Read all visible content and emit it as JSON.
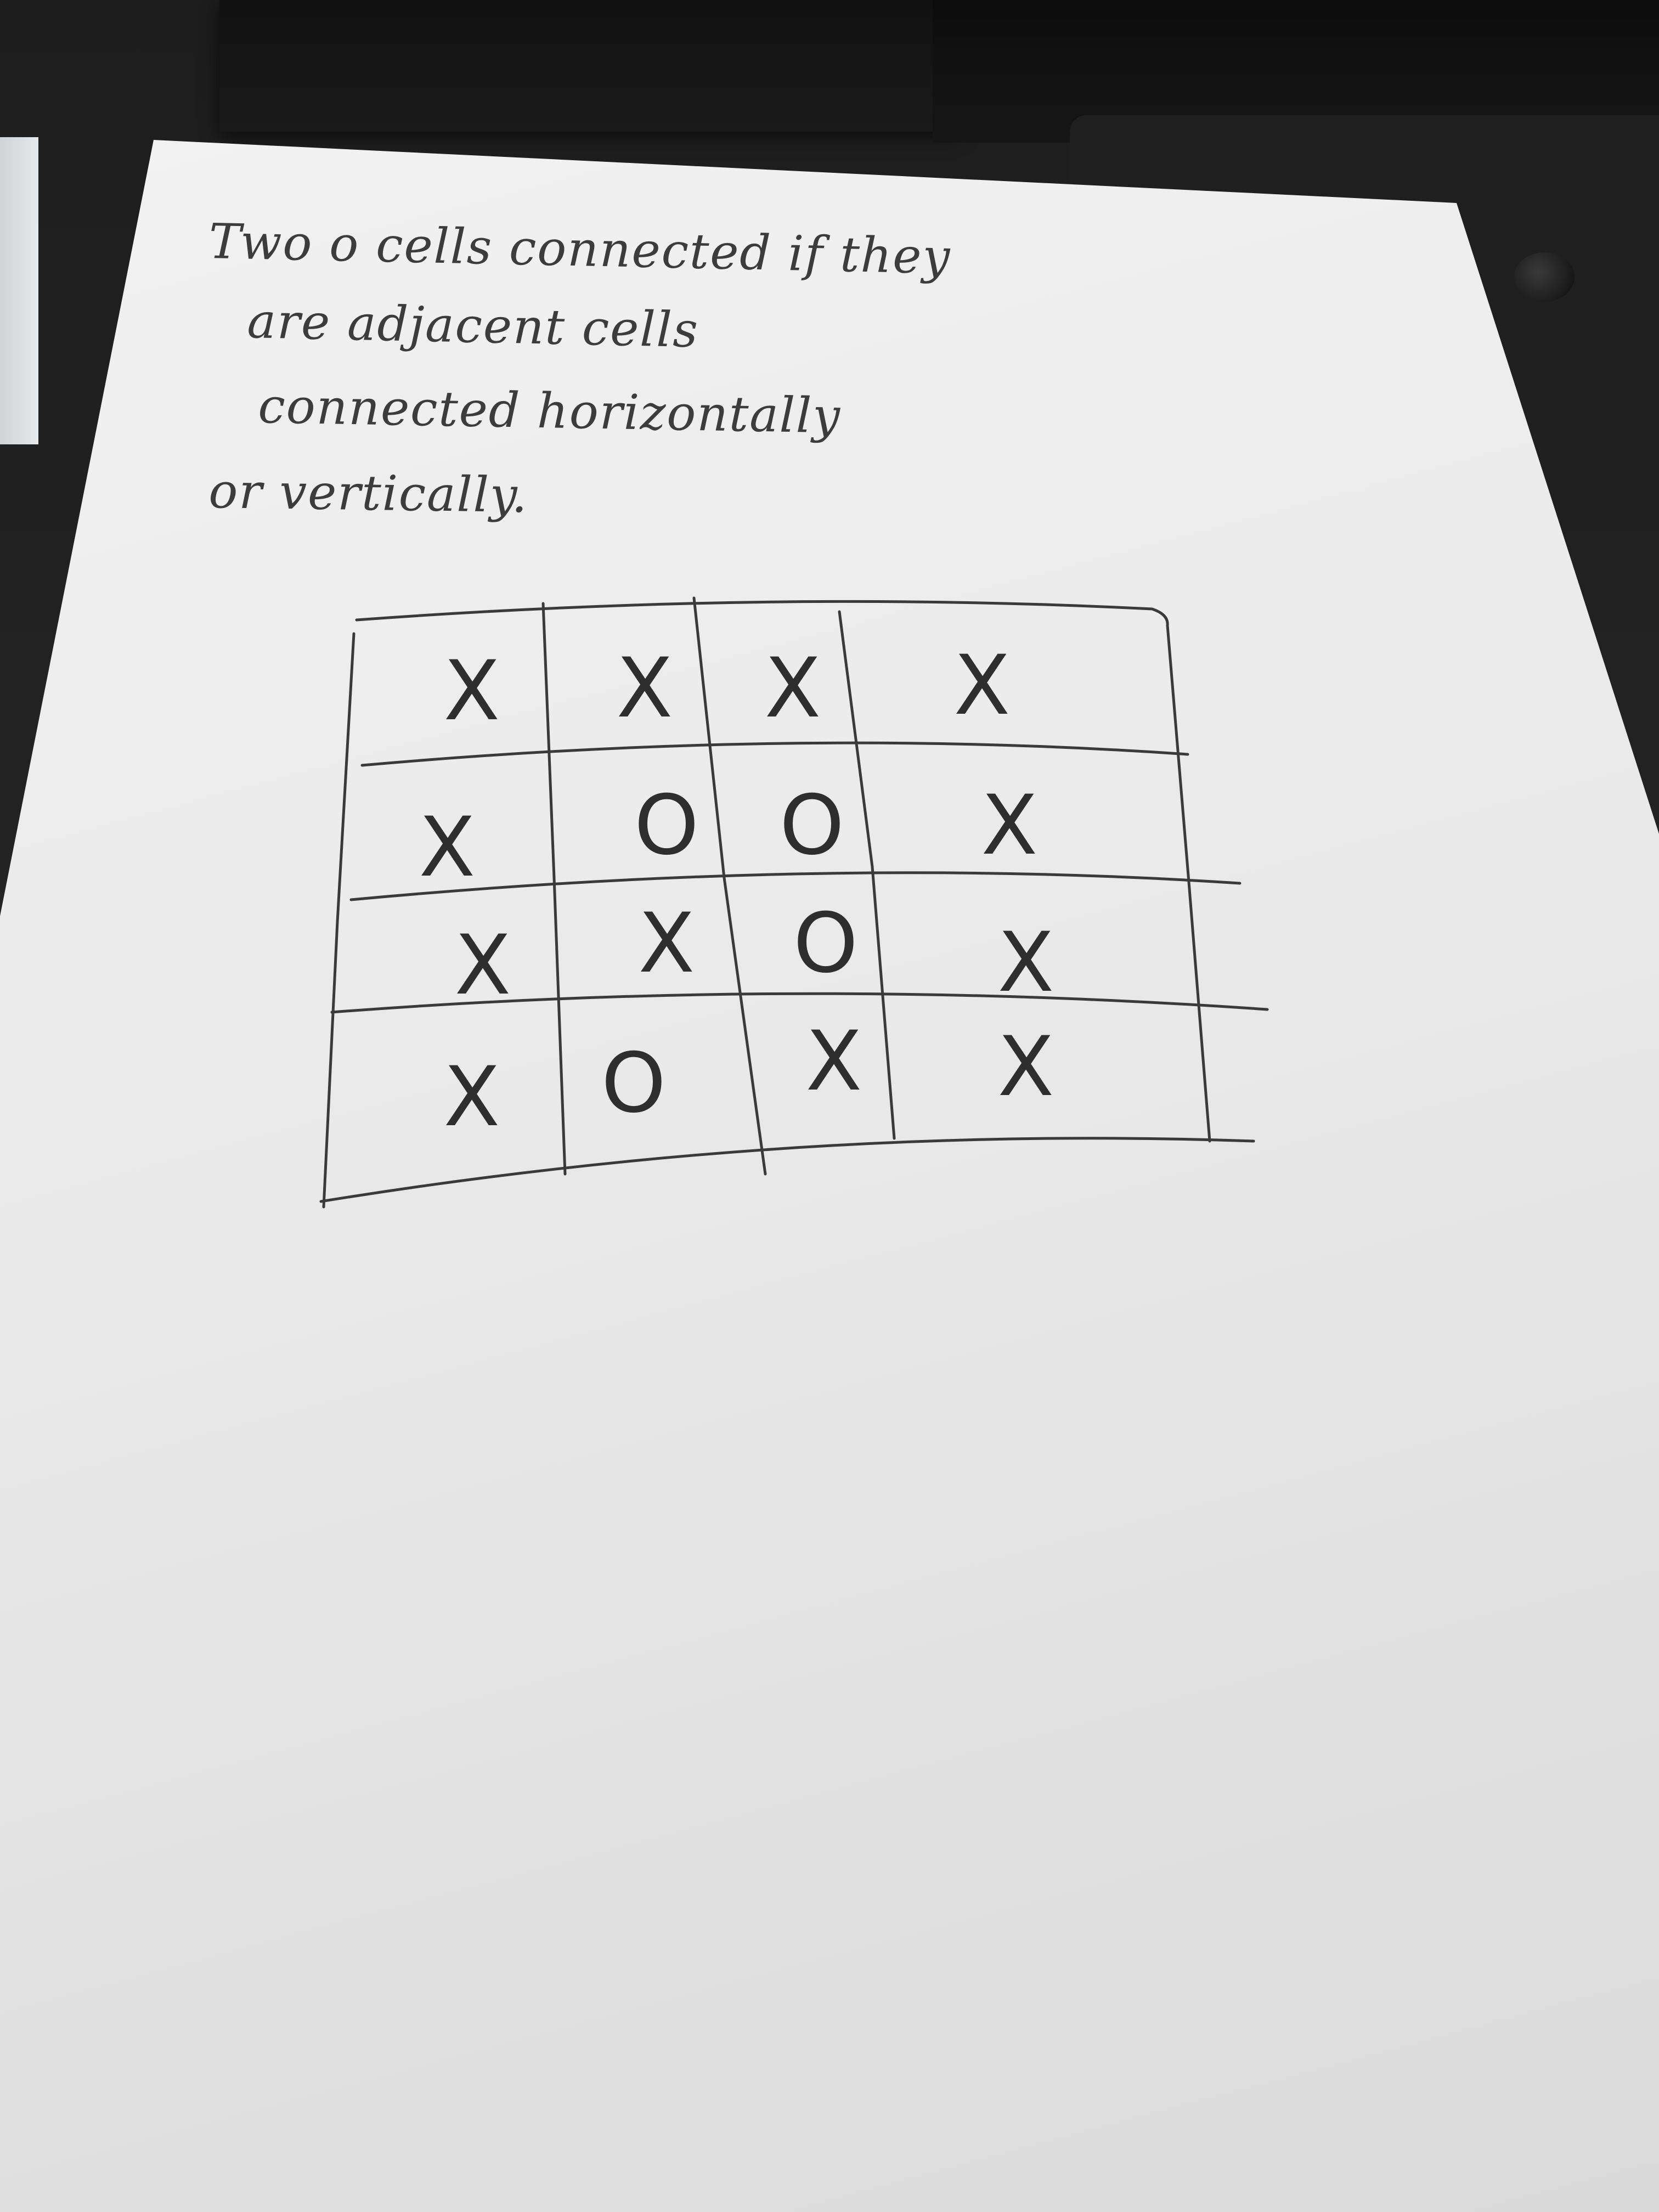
{
  "note": {
    "lines": [
      "Two o cells connected if they",
      "are adjacent cells",
      "connected horizontally",
      "or vertically."
    ]
  },
  "grid": {
    "rows": [
      [
        "X",
        "X",
        "X",
        "X"
      ],
      [
        "X",
        "O",
        "O",
        "X"
      ],
      [
        "X",
        "X",
        "O",
        "X"
      ],
      [
        "X",
        "O",
        "X",
        "X"
      ]
    ]
  }
}
